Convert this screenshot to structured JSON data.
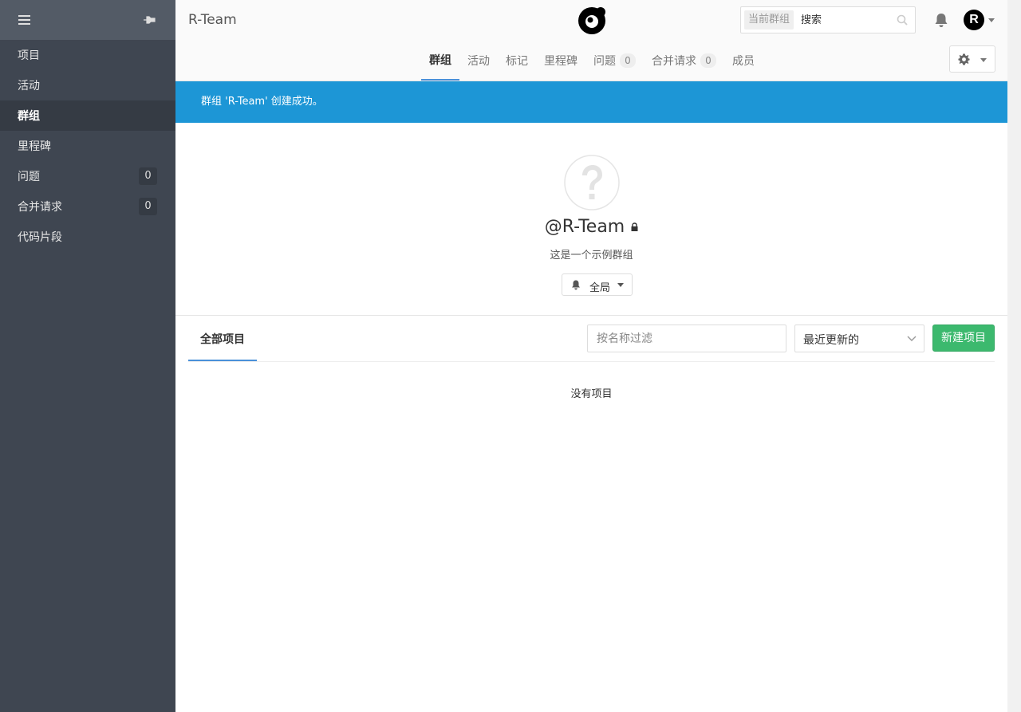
{
  "sidebar": {
    "items": [
      {
        "label": "项目",
        "active": false
      },
      {
        "label": "活动",
        "active": false
      },
      {
        "label": "群组",
        "active": true
      },
      {
        "label": "里程碑",
        "active": false
      },
      {
        "label": "问题",
        "active": false,
        "count": "0"
      },
      {
        "label": "合并请求",
        "active": false,
        "count": "0"
      },
      {
        "label": "代码片段",
        "active": false
      }
    ]
  },
  "header": {
    "title": "R-Team",
    "search": {
      "scope": "当前群组",
      "placeholder": "搜索"
    },
    "avatar_letter": "R",
    "tabs": [
      {
        "label": "群组",
        "active": true
      },
      {
        "label": "活动"
      },
      {
        "label": "标记"
      },
      {
        "label": "里程碑"
      },
      {
        "label": "问题",
        "count": "0"
      },
      {
        "label": "合并请求",
        "count": "0"
      },
      {
        "label": "成员"
      }
    ]
  },
  "flash": {
    "message": "群组 'R-Team' 创建成功。"
  },
  "group": {
    "name": "@R-Team",
    "description": "这是一个示例群组",
    "notification_level": "全局"
  },
  "projects": {
    "tab_label": "全部项目",
    "filter_placeholder": "按名称过滤",
    "sort_value": "最近更新的",
    "new_button": "新建项目",
    "empty_message": "没有项目"
  },
  "colors": {
    "sidebar_bg": "#3f4651",
    "flash_bg": "#1d96d6",
    "primary_green": "#3cb96e",
    "tab_underline": "#4a90d9"
  }
}
